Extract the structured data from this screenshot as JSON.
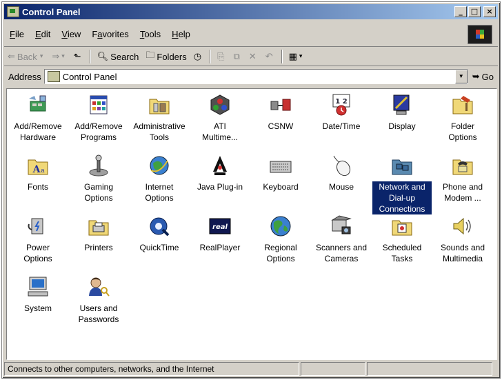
{
  "window": {
    "title": "Control Panel"
  },
  "menu": [
    {
      "label_pre": "",
      "label_u": "F",
      "label_post": "ile"
    },
    {
      "label_pre": "",
      "label_u": "E",
      "label_post": "dit"
    },
    {
      "label_pre": "",
      "label_u": "V",
      "label_post": "iew"
    },
    {
      "label_pre": "F",
      "label_u": "a",
      "label_post": "vorites"
    },
    {
      "label_pre": "",
      "label_u": "T",
      "label_post": "ools"
    },
    {
      "label_pre": "",
      "label_u": "H",
      "label_post": "elp"
    }
  ],
  "toolbar": {
    "back": "Back",
    "search": "Search",
    "folders": "Folders"
  },
  "address": {
    "label": "Address",
    "value": "Control Panel",
    "go": "Go"
  },
  "items": [
    {
      "l1": "Add/Remove",
      "l2": "Hardware"
    },
    {
      "l1": "Add/Remove",
      "l2": "Programs"
    },
    {
      "l1": "Administrative",
      "l2": "Tools"
    },
    {
      "l1": "ATI",
      "l2": "Multime..."
    },
    {
      "l1": "CSNW",
      "l2": ""
    },
    {
      "l1": "Date/Time",
      "l2": ""
    },
    {
      "l1": "Display",
      "l2": ""
    },
    {
      "l1": "Folder",
      "l2": "Options"
    },
    {
      "l1": "Fonts",
      "l2": ""
    },
    {
      "l1": "Gaming",
      "l2": "Options"
    },
    {
      "l1": "Internet",
      "l2": "Options"
    },
    {
      "l1": "Java Plug-in",
      "l2": ""
    },
    {
      "l1": "Keyboard",
      "l2": ""
    },
    {
      "l1": "Mouse",
      "l2": ""
    },
    {
      "l1": "Network and",
      "l2": "Dial-up",
      "l3": "Connections"
    },
    {
      "l1": "Phone and",
      "l2": "Modem ..."
    },
    {
      "l1": "Power",
      "l2": "Options"
    },
    {
      "l1": "Printers",
      "l2": ""
    },
    {
      "l1": "QuickTime",
      "l2": ""
    },
    {
      "l1": "RealPlayer",
      "l2": ""
    },
    {
      "l1": "Regional",
      "l2": "Options"
    },
    {
      "l1": "Scanners and",
      "l2": "Cameras"
    },
    {
      "l1": "Scheduled",
      "l2": "Tasks"
    },
    {
      "l1": "Sounds and",
      "l2": "Multimedia"
    },
    {
      "l1": "System",
      "l2": ""
    },
    {
      "l1": "Users and",
      "l2": "Passwords"
    }
  ],
  "selected_item": "Network and Dial-up Connections",
  "status": {
    "text": "Connects to other computers, networks, and the Internet"
  },
  "icons": {
    "date_time_calendar": "1 2",
    "realplayer_logo": "real"
  }
}
